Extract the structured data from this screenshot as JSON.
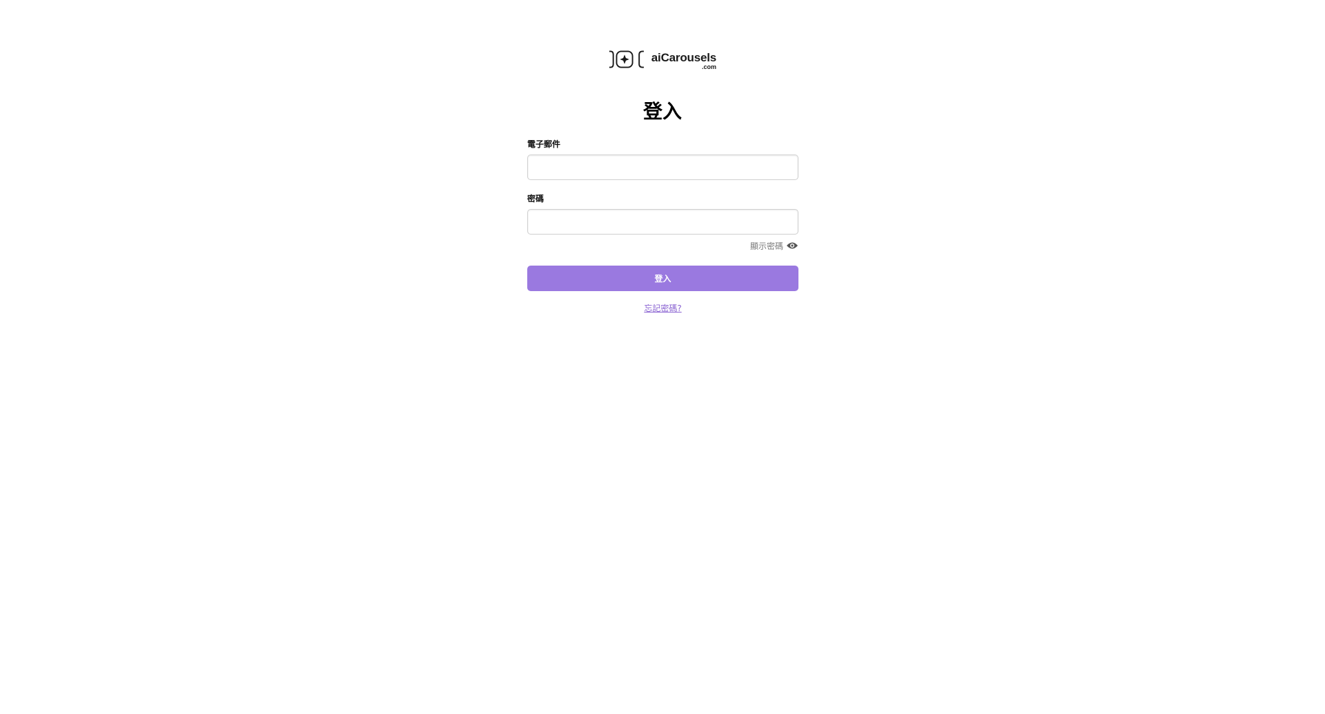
{
  "brand": {
    "name": "aiCarousels",
    "suffix": ".com",
    "logo_icon": "carousel-sparkle-icon"
  },
  "page": {
    "title": "登入"
  },
  "form": {
    "email_label": "電子郵件",
    "email_value": "",
    "password_label": "密碼",
    "password_value": "",
    "show_password_label": "顯示密碼",
    "show_password_icon": "eye-icon",
    "submit_label": "登入",
    "forgot_password_label": "忘記密碼?"
  },
  "colors": {
    "accent": "#9a79e0",
    "link": "#8a63d2",
    "muted_text": "#7a7a7a"
  }
}
